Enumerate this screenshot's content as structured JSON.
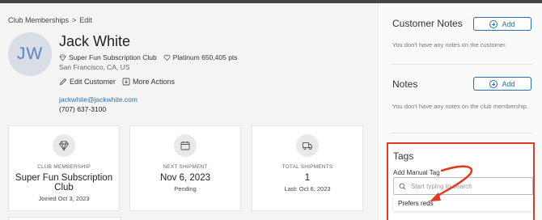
{
  "breadcrumb": {
    "parent": "Club Memberships",
    "separator": ">",
    "current": "Edit"
  },
  "customer": {
    "initials": "JW",
    "name": "Jack White",
    "club": "Super Fun Subscription Club",
    "tier_points": "Platinum 650,405 pts",
    "location": "San Francisco, CA, US",
    "edit_label": "Edit Customer",
    "more_label": "More Actions",
    "email": "jackwhite@jackwhite.com",
    "phone": "(707) 637-3100"
  },
  "cards": [
    {
      "label": "CLUB MEMBERSHIP",
      "value": "Super Fun Subscription Club",
      "sub": "Joined Oct 3, 2023",
      "icon": "diamond-icon"
    },
    {
      "label": "NEXT SHIPMENT",
      "value": "Nov 6, 2023",
      "sub": "Pending",
      "icon": "calendar-icon"
    },
    {
      "label": "TOTAL SHIPMENTS",
      "value": "1",
      "sub": "Last: Oct 6, 2023",
      "icon": "truck-icon"
    }
  ],
  "sidebar": {
    "customer_notes": {
      "title": "Customer Notes",
      "button": "Add",
      "empty": "You don't have any notes on the customer."
    },
    "notes": {
      "title": "Notes",
      "button": "Add",
      "empty": "You don't have any notes on the club membership."
    },
    "tags": {
      "title": "Tags",
      "add_label": "Add Manual Tag",
      "placeholder": "Start typing to search",
      "suggestion": "Prefers reds"
    }
  },
  "colors": {
    "accent": "#2a6fb5",
    "highlight": "#e03a23",
    "avatar_bg": "#d8dde6"
  }
}
